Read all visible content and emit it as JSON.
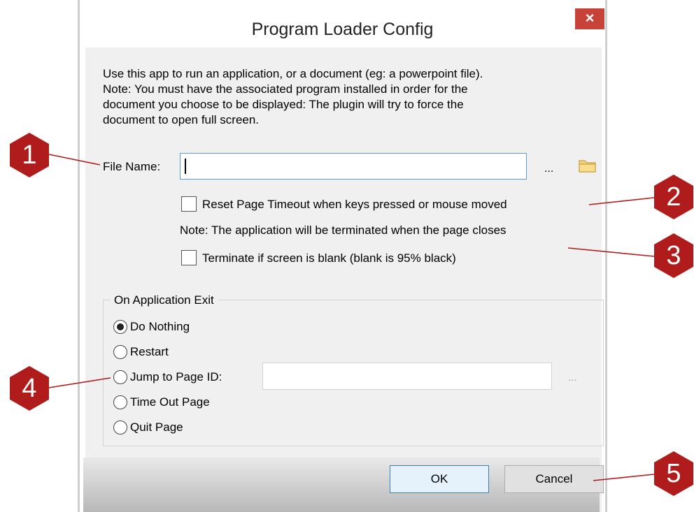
{
  "window": {
    "title": "Program Loader Config",
    "close_glyph": "×"
  },
  "description": [
    "Use this app to run an application, or a document (eg: a powerpoint file).",
    "Note: You must have the associated program installed in order for the",
    "document you choose to be displayed:  The plugin will try to force the",
    "document to open full screen."
  ],
  "file": {
    "label": "File Name:",
    "value": "",
    "browse_label": "...",
    "folder_icon": "folder-icon"
  },
  "options": {
    "reset_timeout": {
      "label": "Reset Page Timeout when keys pressed or mouse moved",
      "checked": false
    },
    "note": "Note: The application will be terminated when the page closes",
    "terminate_blank": {
      "label": "Terminate if screen is blank  (blank is 95% black)",
      "checked": false
    }
  },
  "exit_group": {
    "title": "On Application Exit",
    "options": [
      "Do Nothing",
      "Restart",
      "Jump to Page ID:",
      "Time Out Page",
      "Quit Page"
    ],
    "selected": "Do Nothing",
    "page_id_value": "",
    "page_browse_label": "..."
  },
  "buttons": {
    "ok": "OK",
    "cancel": "Cancel"
  },
  "callouts": [
    "1",
    "2",
    "3",
    "4",
    "5"
  ],
  "colors": {
    "callout": "#b01c1c",
    "close_button": "#c7433a",
    "input_focus_border": "#5b9bd5"
  }
}
